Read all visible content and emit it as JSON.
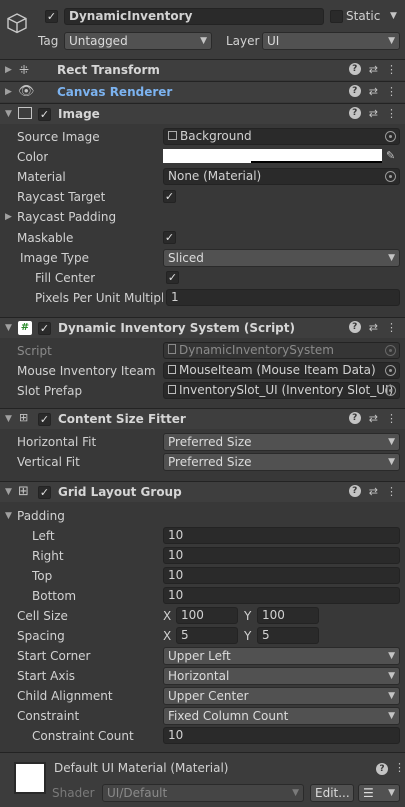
{
  "header": {
    "active": true,
    "name": "DynamicInventory",
    "static_label": "Static",
    "tag_label": "Tag",
    "tag_value": "Untagged",
    "layer_label": "Layer",
    "layer_value": "UI"
  },
  "components": {
    "rect_transform": {
      "title": "Rect Transform"
    },
    "canvas_renderer": {
      "title": "Canvas Renderer"
    },
    "image": {
      "title": "Image",
      "enabled": true,
      "source_image_label": "Source Image",
      "source_image_value": "Background",
      "color_label": "Color",
      "material_label": "Material",
      "material_value": "None (Material)",
      "raycast_target_label": "Raycast Target",
      "raycast_padding_label": "Raycast Padding",
      "maskable_label": "Maskable",
      "image_type_label": "Image Type",
      "image_type_value": "Sliced",
      "fill_center_label": "Fill Center",
      "ppu_label": "Pixels Per Unit Multiplie",
      "ppu_value": "1"
    },
    "dynamic_inventory": {
      "title": "Dynamic Inventory System (Script)",
      "script_label": "Script",
      "script_value": "DynamicInventorySystem",
      "mouse_label": "Mouse Inventory Iteam",
      "mouse_value": "MouseIteam (Mouse Iteam Data)",
      "slot_label": "Slot Prefap",
      "slot_value": "InventorySlot_UI (Inventory Slot_UI)"
    },
    "content_size_fitter": {
      "title": "Content Size Fitter",
      "hfit_label": "Horizontal Fit",
      "hfit_value": "Preferred Size",
      "vfit_label": "Vertical Fit",
      "vfit_value": "Preferred Size"
    },
    "grid_layout": {
      "title": "Grid Layout Group",
      "padding_label": "Padding",
      "left_label": "Left",
      "left_value": "10",
      "right_label": "Right",
      "right_value": "10",
      "top_label": "Top",
      "top_value": "10",
      "bottom_label": "Bottom",
      "bottom_value": "10",
      "cell_label": "Cell Size",
      "cell_x": "100",
      "cell_y": "100",
      "spacing_label": "Spacing",
      "spacing_x": "5",
      "spacing_y": "5",
      "x_label": "X",
      "y_label": "Y",
      "start_corner_label": "Start Corner",
      "start_corner_value": "Upper Left",
      "start_axis_label": "Start Axis",
      "start_axis_value": "Horizontal",
      "child_align_label": "Child Alignment",
      "child_align_value": "Upper Center",
      "constraint_label": "Constraint",
      "constraint_value": "Fixed Column Count",
      "constraint_count_label": "Constraint Count",
      "constraint_count_value": "10"
    }
  },
  "material": {
    "name": "Default UI Material (Material)",
    "shader_label": "Shader",
    "shader_value": "UI/Default",
    "edit_label": "Edit..."
  },
  "colors": {
    "panel": "#383838",
    "header": "#3e3e3e",
    "link": "#7cb3f0",
    "field": "#2a2a2a"
  }
}
